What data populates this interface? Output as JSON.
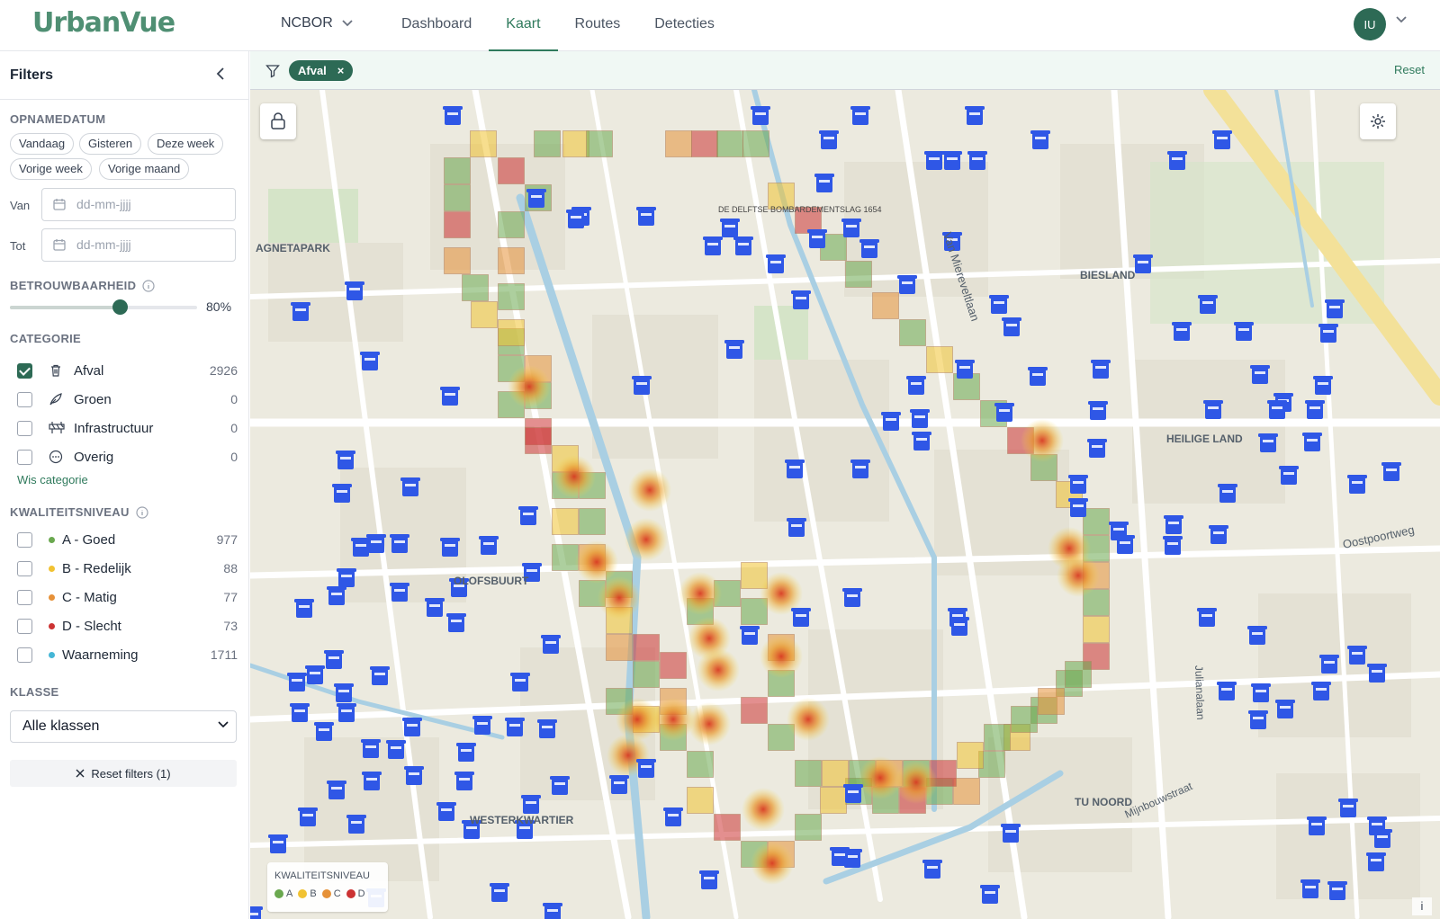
{
  "app": {
    "logo": "UrbanVue",
    "org": "NCBOR",
    "avatar_initials": "IU"
  },
  "nav": [
    {
      "label": "Dashboard",
      "active": false
    },
    {
      "label": "Kaart",
      "active": true
    },
    {
      "label": "Routes",
      "active": false
    },
    {
      "label": "Detecties",
      "active": false
    }
  ],
  "filters": {
    "title": "Filters",
    "opnamedatum": {
      "title": "OPNAMEDATUM",
      "chips": [
        "Vandaag",
        "Gisteren",
        "Deze week",
        "Vorige week",
        "Vorige maand"
      ],
      "van_label": "Van",
      "tot_label": "Tot",
      "van_placeholder": "dd-mm-jjjj",
      "tot_placeholder": "dd-mm-jjjj"
    },
    "betrouwbaarheid": {
      "title": "BETROUWBAARHEID",
      "value_label": "80%",
      "value": 0.8
    },
    "categorie": {
      "title": "CATEGORIE",
      "items": [
        {
          "label": "Afval",
          "count": "2926",
          "checked": true,
          "icon": "trash-icon"
        },
        {
          "label": "Groen",
          "count": "0",
          "checked": false,
          "icon": "leaf-icon"
        },
        {
          "label": "Infrastructuur",
          "count": "0",
          "checked": false,
          "icon": "road-barrier-icon"
        },
        {
          "label": "Overig",
          "count": "0",
          "checked": false,
          "icon": "more-circle-icon"
        }
      ],
      "clear_label": "Wis categorie"
    },
    "kwaliteit": {
      "title": "KWALITEITSNIVEAU",
      "items": [
        {
          "label": "A - Goed",
          "count": "977",
          "color": "#6aa84f"
        },
        {
          "label": "B - Redelijk",
          "count": "88",
          "color": "#f1c232"
        },
        {
          "label": "C - Matig",
          "count": "77",
          "color": "#e69138"
        },
        {
          "label": "D - Slecht",
          "count": "73",
          "color": "#cc3333"
        },
        {
          "label": "Waarneming",
          "count": "1711",
          "color": "#45b6d6"
        }
      ]
    },
    "klasse": {
      "title": "KLASSE",
      "selected": "Alle klassen"
    },
    "reset_label": "Reset filters (1)"
  },
  "active_filters": {
    "tag": "Afval",
    "reset": "Reset"
  },
  "map": {
    "labels": [
      "AGNETAPARK",
      "BIESLAND",
      "HEILIGE LAND",
      "OLOFSBUURT",
      "WESTERKWARTIER",
      "TU NOORD",
      "Van Miereveltlaan",
      "Oostpoortweg",
      "Julianalaan",
      "Mijnbouwstraat"
    ],
    "poi_label": "DE DELFTSE BOMBARDEMENTSLAG 1654",
    "legend": {
      "title": "KWALITEITSNIVEAU",
      "items": [
        "A",
        "B",
        "C",
        "D"
      ],
      "colors": [
        "#6aa84f",
        "#f1c232",
        "#e69138",
        "#cc3333"
      ]
    },
    "info": "i"
  }
}
